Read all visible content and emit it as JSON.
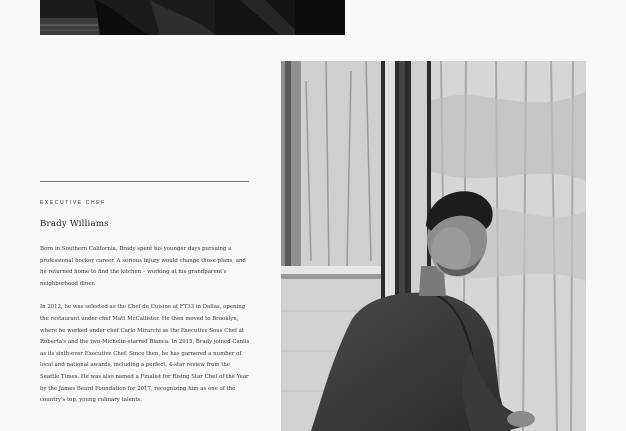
{
  "profile": {
    "role": "EXECUTIVE CHEF",
    "name": "Brady Williams",
    "paragraphs": [
      "Born in Southern California, Brady spent his younger days pursuing a professional hockey career. A serious injury would change those plans, and he returned home to find the kitchen – working at his grandparent's neighborhood diner.",
      "In 2012, he was selected as the Chef de Cuisine at FT33 in Dallas, opening the restaurant under chef Matt McCallister. He then moved to Brooklyn, where he worked under chef Carlo Mirarchi as the Executive Sous Chef at Roberta's and the two-Michelin-starred Blanca. In 2015, Brady joined Canlis as its sixth-ever Executive Chef. Since then, he has garnered a number of local and national awards, including a perfect, 4-star review from the Seattle Times. He was also named a Finalist for Rising Star Chef of the Year by the James Beard Foundation for 2017, recognizing him as one of the country's top, young culinary talents."
    ]
  },
  "images": {
    "top": "dark-photo",
    "portrait": "chef-portrait-photo"
  },
  "colors": {
    "background": "#f9f8f6",
    "text": "#2a2a2a",
    "rule": "#777777"
  }
}
